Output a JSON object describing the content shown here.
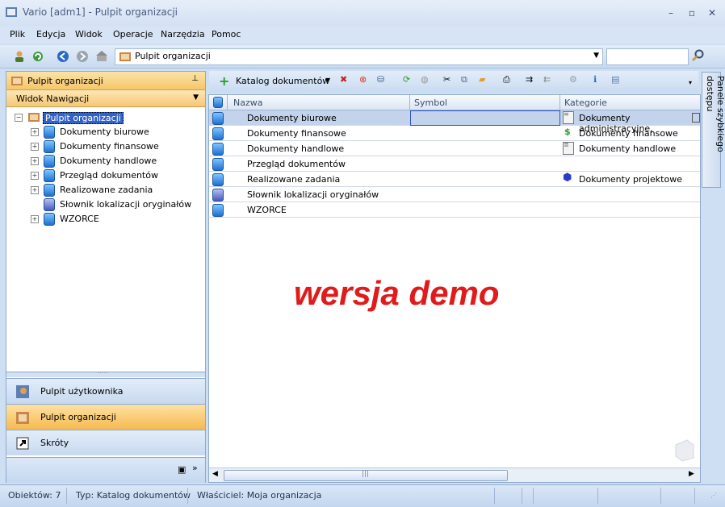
{
  "window": {
    "title": "Vario [adm1] - Pulpit organizacji",
    "controls": [
      "–",
      "▫",
      "✕"
    ]
  },
  "menu": [
    "Plik",
    "Edycja",
    "Widok",
    "Operacje",
    "Narzędzia",
    "Pomoc"
  ],
  "address": {
    "value": "Pulpit organizacji",
    "search_placeholder": ""
  },
  "left_panel": {
    "header": "Pulpit organizacji",
    "view_selector": "Widok Nawigacji",
    "tree_root": "Pulpit organizacji",
    "tree_items": [
      "Dokumenty biurowe",
      "Dokumenty finansowe",
      "Dokumenty handlowe",
      "Przegląd dokumentów",
      "Realizowane zadania",
      "Słownik lokalizacji oryginałów",
      "WZORCE"
    ],
    "nav_buttons": [
      "Pulpit użytkownika",
      "Pulpit organizacji",
      "Skróty"
    ],
    "active_nav": "Pulpit organizacji"
  },
  "right_toolbar": {
    "new_label": "Katalog dokumentów"
  },
  "grid": {
    "columns": [
      "Nazwa",
      "Symbol",
      "Kategorie"
    ],
    "rows": [
      {
        "name": "Dokumenty biurowe",
        "symbol": "",
        "category": "Dokumenty administracyjne,",
        "cat_icon": "document-icon"
      },
      {
        "name": "Dokumenty finansowe",
        "symbol": "",
        "category": "Dokumenty finansowe",
        "cat_icon": "dollar-icon"
      },
      {
        "name": "Dokumenty handlowe",
        "symbol": "",
        "category": "Dokumenty handlowe",
        "cat_icon": "sheet-icon"
      },
      {
        "name": "Przegląd dokumentów",
        "symbol": "",
        "category": "",
        "cat_icon": ""
      },
      {
        "name": "Realizowane zadania",
        "symbol": "",
        "category": "Dokumenty projektowe",
        "cat_icon": "hexagon-icon"
      },
      {
        "name": "Słownik lokalizacji oryginałów",
        "symbol": "",
        "category": "",
        "cat_icon": ""
      },
      {
        "name": "WZORCE",
        "symbol": "",
        "category": "",
        "cat_icon": ""
      }
    ],
    "selected_row": 0
  },
  "watermark": "wersja demo",
  "quick_access_panel": "Panele szybkiego dostępu",
  "statusbar": {
    "objects": "Obiektów: 7",
    "type": "Typ: Katalog dokumentów",
    "owner": "Właściciel: Moja organizacja"
  },
  "colors": {
    "accent": "#f6c66a",
    "watermark": "#e01b1b",
    "frame": "#cfdff3"
  }
}
